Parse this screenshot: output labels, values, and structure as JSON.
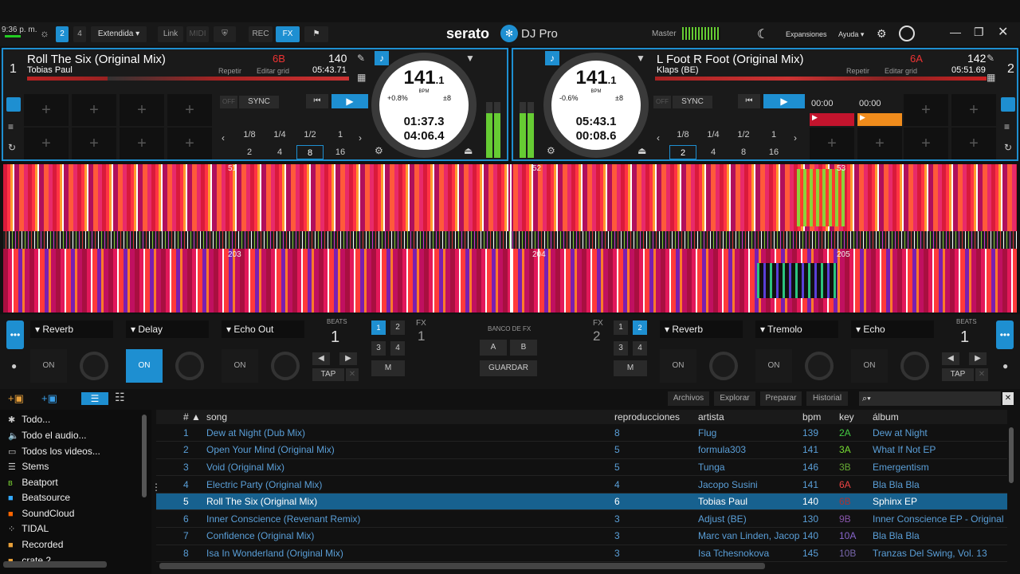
{
  "clock": "9:36 p. m.",
  "topbar": {
    "deck2": "2",
    "deck4": "4",
    "mode": "Extendida",
    "link": "Link",
    "midi": "MIDI",
    "rec": "REC",
    "fx": "FX",
    "logo": "serato",
    "logo2": "DJ Pro",
    "master": "Master",
    "expansiones": "Expansiones",
    "ayuda": "Ayuda"
  },
  "deck1": {
    "num": "1",
    "title": "Roll The Six (Original Mix)",
    "artist": "Tobias Paul",
    "repetir": "Repetir",
    "editar": "Editar grid",
    "key": "6B",
    "bpm": "140",
    "time": "05:43.71",
    "bpm_big": "141",
    "bpm_dec": ".1",
    "bpm_label": "BPM",
    "pitch": "+0.8%",
    "range": "±8",
    "elapsed": "01:37.3",
    "remain": "04:06.4",
    "off": "OFF",
    "sync": "SYNC",
    "loops_top": [
      "1/8",
      "1/4",
      "1/2",
      "1"
    ],
    "loops_bot": [
      "2",
      "4",
      "8",
      "16"
    ],
    "selected_loop": "8"
  },
  "deck2": {
    "num": "2",
    "title": "L Foot R Foot (Original Mix)",
    "artist": "Klaps (BE)",
    "repetir": "Repetir",
    "editar": "Editar grid",
    "key": "6A",
    "bpm": "142",
    "time": "05:51.69",
    "bpm_big": "141",
    "bpm_dec": ".1",
    "bpm_label": "BPM",
    "pitch": "-0.6%",
    "range": "±8",
    "elapsed": "05:43.1",
    "remain": "00:08.6",
    "off": "OFF",
    "sync": "SYNC",
    "loops_top": [
      "1/8",
      "1/4",
      "1/2",
      "1"
    ],
    "loops_bot": [
      "2",
      "4",
      "8",
      "16"
    ],
    "selected_loop": "2",
    "cue1": "00:00",
    "cue2": "00:00"
  },
  "waveform": {
    "beat1": "51",
    "beat2": "52",
    "beat3": "53",
    "beat4": "203",
    "beat5": "204",
    "beat6": "205"
  },
  "fx1": {
    "slot1": "Reverb",
    "slot2": "Delay",
    "slot3": "Echo Out",
    "on": "ON",
    "beats": "BEATS",
    "beats_val": "1",
    "tap": "TAP",
    "m": "M",
    "fx_label": "FX",
    "fx_num": "1",
    "units": [
      "1",
      "2",
      "3",
      "4"
    ]
  },
  "fx2": {
    "slot1": "Reverb",
    "slot2": "Tremolo",
    "slot3": "Echo",
    "on": "ON",
    "beats": "BEATS",
    "beats_val": "1",
    "tap": "TAP",
    "m": "M",
    "fx_label": "FX",
    "fx_num": "2",
    "units": [
      "1",
      "2",
      "3",
      "4"
    ]
  },
  "fxbank": {
    "label": "BANCO DE FX",
    "a": "A",
    "b": "B",
    "guardar": "GUARDAR"
  },
  "tabs": {
    "archivos": "Archivos",
    "explorar": "Explorar",
    "preparar": "Preparar",
    "historial": "Historial"
  },
  "crates": [
    "Todo...",
    "Todo el audio...",
    "Todos los videos...",
    "Stems",
    "Beatport",
    "Beatsource",
    "SoundCloud",
    "TIDAL",
    "Recorded",
    "crate 2"
  ],
  "columns": {
    "num": "#",
    "song": "song",
    "plays": "reproducciones",
    "artist": "artista",
    "bpm": "bpm",
    "key": "key",
    "album": "álbum"
  },
  "tracks": [
    {
      "n": "1",
      "song": "Dew at Night (Dub Mix)",
      "plays": "8",
      "artist": "Flug",
      "bpm": "139",
      "key": "2A",
      "key_color": "#4c4",
      "album": "Dew at Night"
    },
    {
      "n": "2",
      "song": "Open Your Mind (Original Mix)",
      "plays": "5",
      "artist": "formula303",
      "bpm": "141",
      "key": "3A",
      "key_color": "#7d3",
      "album": "What If Not EP"
    },
    {
      "n": "3",
      "song": "Void (Original Mix)",
      "plays": "5",
      "artist": "Tunga",
      "bpm": "146",
      "key": "3B",
      "key_color": "#6a3",
      "album": "Emergentism"
    },
    {
      "n": "4",
      "song": "Electric Party (Original Mix)",
      "plays": "4",
      "artist": "Jacopo Susini",
      "bpm": "141",
      "key": "6A",
      "key_color": "#e44",
      "album": "Bla Bla Bla"
    },
    {
      "n": "5",
      "song": "Roll The Six (Original Mix)",
      "plays": "6",
      "artist": "Tobias Paul",
      "bpm": "140",
      "key": "6B",
      "key_color": "#a33",
      "album": "Sphinx EP"
    },
    {
      "n": "6",
      "song": "Inner Conscience (Revenant Remix)",
      "plays": "3",
      "artist": "Adjust (BE)",
      "bpm": "130",
      "key": "9B",
      "key_color": "#85a",
      "album": "Inner Conscience EP - Original"
    },
    {
      "n": "7",
      "song": "Confidence (Original Mix)",
      "plays": "3",
      "artist": "Marc van Linden, Jacop",
      "bpm": "140",
      "key": "10A",
      "key_color": "#86c",
      "album": "Bla Bla Bla"
    },
    {
      "n": "8",
      "song": "Isa In Wonderland (Original Mix)",
      "plays": "3",
      "artist": "Isa Tchesnokova",
      "bpm": "145",
      "key": "10B",
      "key_color": "#76a",
      "album": "Tranzas Del Swing, Vol. 13"
    }
  ]
}
